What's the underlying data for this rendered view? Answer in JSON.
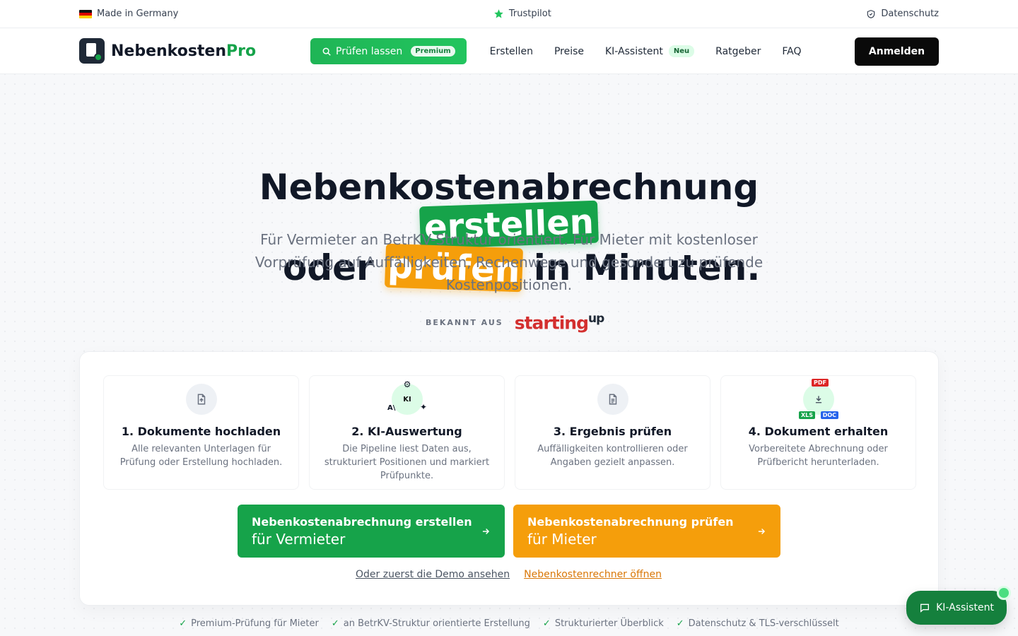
{
  "topbar": {
    "made_in": "Made in Germany",
    "trustpilot": "Trustpilot",
    "privacy": "Datenschutz"
  },
  "nav": {
    "logo_main": "Nebenkosten",
    "logo_accent": "Pro",
    "check_label": "Prüfen lassen",
    "check_badge": "Premium",
    "links": [
      "Erstellen",
      "Preise",
      "KI-Assistent",
      "Ratgeber",
      "FAQ"
    ],
    "ai_badge": "Neu",
    "login": "Anmelden"
  },
  "hero": {
    "line1": "Nebenkostenabrechnung",
    "highlight_green": "erstellen",
    "line3_pre": "oder",
    "highlight_orange": "prüfen",
    "line3_post": "in Minuten.",
    "subtitle": "Für Vermieter an BetrKV-Struktur orientiert. Für Mieter mit kostenloser Vorprüfung auf Auffälligkeiten, Rechenwege und gesondert zu prüfende Kostenpositionen.",
    "known_label": "BEKANNT AUS",
    "known_brand": "starting",
    "known_brand_sup": "up"
  },
  "steps": [
    {
      "title": "1. Dokumente hochladen",
      "desc": "Alle relevanten Unterlagen für Prüfung oder Erstellung hochladen."
    },
    {
      "title": "2. KI-Auswertung",
      "desc": "Die Pipeline liest Daten aus, strukturiert Positionen und markiert Prüfpunkte.",
      "icon_label": "KI"
    },
    {
      "title": "3. Ergebnis prüfen",
      "desc": "Auffälligkeiten kontrollieren oder Angaben gezielt anpassen."
    },
    {
      "title": "4. Dokument erhalten",
      "desc": "Vorbereitete Abrechnung oder Prüfbericht herunterladen.",
      "formats": [
        "PDF",
        "XLS",
        "DOC"
      ]
    }
  ],
  "cta": {
    "create_title": "Nebenkostenabrechnung erstellen",
    "create_sub": "für Vermieter",
    "check_title": "Nebenkostenabrechnung prüfen",
    "check_sub": "für Mieter"
  },
  "links": {
    "demo": "Oder zuerst die Demo ansehen",
    "calculator": "Nebenkostenrechner öffnen"
  },
  "features": [
    "Premium-Prüfung für Mieter",
    "an BetrKV-Struktur orientierte Erstellung",
    "Strukturierter Überblick",
    "Datenschutz & TLS-verschlüsselt"
  ],
  "chat": {
    "label": "KI-Assistent"
  },
  "colors": {
    "green": "#16a34a",
    "orange": "#f59e0b",
    "dark": "#0a0a0a"
  }
}
